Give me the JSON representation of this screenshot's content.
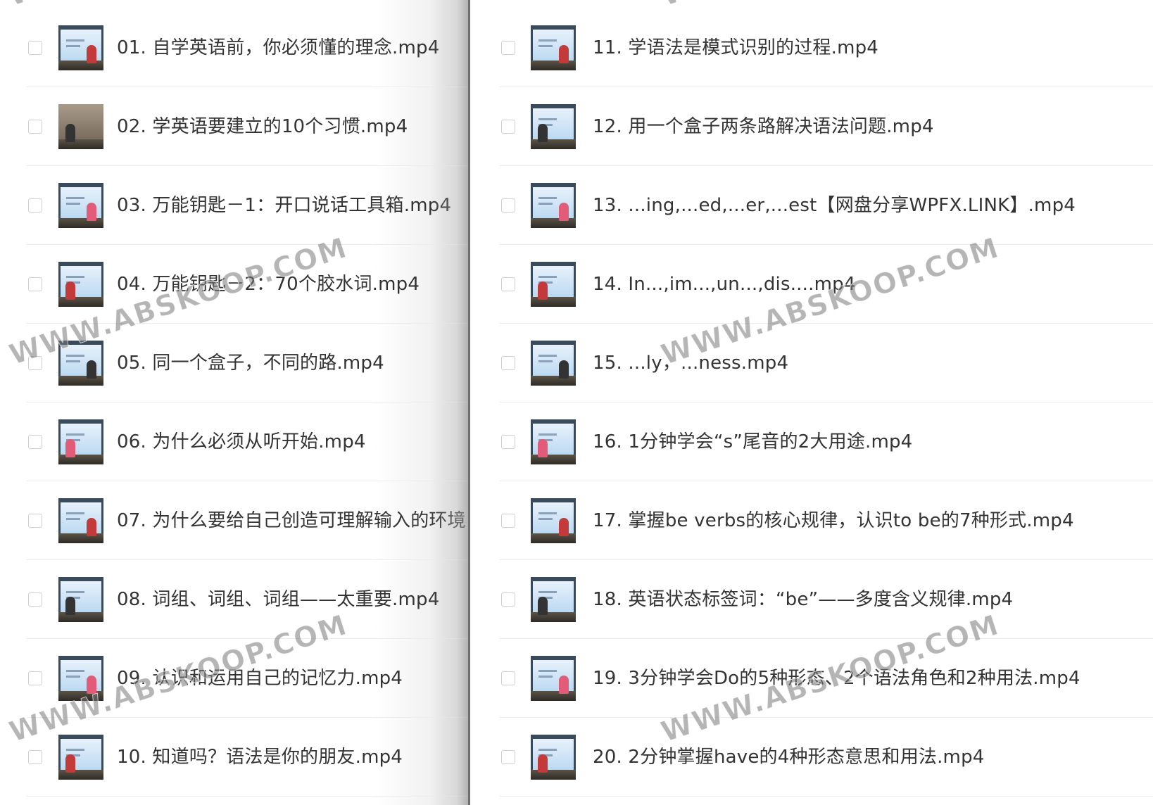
{
  "left_list": [
    {
      "label": "01. 自学英语前，你必须懂的理念.mp4",
      "thumb": "lecture-slide-icon"
    },
    {
      "label": "02. 学英语要建立的10个习惯.mp4",
      "thumb": "interview-photo-icon"
    },
    {
      "label": "03. 万能钥匙－1：开口说话工具箱.mp4",
      "thumb": "lecture-slide-icon"
    },
    {
      "label": "04. 万能钥匙－2：70个胶水词.mp4",
      "thumb": "lecture-slide-icon"
    },
    {
      "label": "05. 同一个盒子，不同的路.mp4",
      "thumb": "lecture-slide-icon"
    },
    {
      "label": "06. 为什么必须从听开始.mp4",
      "thumb": "lecture-slide-icon"
    },
    {
      "label": "07. 为什么要给自己创造可理解输入的环境",
      "thumb": "lecture-slide-icon"
    },
    {
      "label": "08. 词组、词组、词组——太重要.mp4",
      "thumb": "lecture-slide-icon"
    },
    {
      "label": "09. 认识和运用自己的记忆力.mp4",
      "thumb": "lecture-slide-icon"
    },
    {
      "label": "10. 知道吗？语法是你的朋友.mp4",
      "thumb": "lecture-slide-icon"
    }
  ],
  "right_list": [
    {
      "label": "11. 学语法是模式识别的过程.mp4",
      "thumb": "lecture-slide-icon"
    },
    {
      "label": "12. 用一个盒子两条路解决语法问题.mp4",
      "thumb": "lecture-slide-icon"
    },
    {
      "label": "13. ...ing,...ed,...er,...est【网盘分享WPFX.LINK】.mp4",
      "thumb": "lecture-slide-icon"
    },
    {
      "label": "14. In...,im...,un...,dis....mp4",
      "thumb": "lecture-slide-icon"
    },
    {
      "label": "15. ...ly，...ness.mp4",
      "thumb": "lecture-slide-icon"
    },
    {
      "label": "16. 1分钟学会“s”尾音的2大用途.mp4",
      "thumb": "lecture-slide-icon"
    },
    {
      "label": "17. 掌握be verbs的核心规律，认识to be的7种形式.mp4",
      "thumb": "lecture-slide-icon"
    },
    {
      "label": "18. 英语状态标签词：“be”——多度含义规律.mp4",
      "thumb": "lecture-slide-icon"
    },
    {
      "label": "19. 3分钟学会Do的5种形态、2个语法角色和2种用法.mp4",
      "thumb": "lecture-slide-icon"
    },
    {
      "label": "20. 2分钟掌握have的4种形态意思和用法.mp4",
      "thumb": "lecture-slide-icon"
    }
  ],
  "watermark_text": "WWW.ABSKOOP.COM",
  "colors": {
    "text": "#333333",
    "checkbox_border": "#cfcfcf",
    "divider": "#ececec",
    "fold": "#6f6f6f"
  }
}
